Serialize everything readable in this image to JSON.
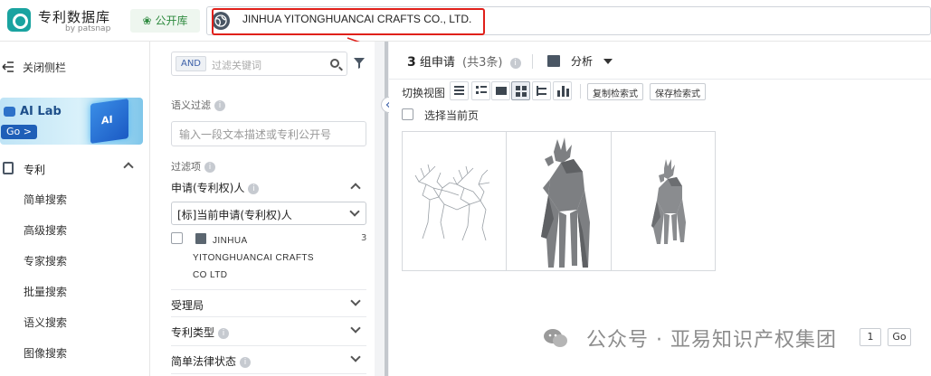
{
  "app": {
    "title": "专利数据库",
    "subtitle": "by patsnap",
    "brand_color": "#1aa3a0",
    "public_db_label": "公开库"
  },
  "search": {
    "query": "JINHUA YITONGHUANCAI CRAFTS CO., LTD.",
    "highlight_color": "#e0201a"
  },
  "sidebar": {
    "collapse_label": "关闭侧栏",
    "ailab": {
      "title": "AI Lab",
      "go": "Go >",
      "cube_text": "AI"
    },
    "patent_label": "专利",
    "items": [
      {
        "label": "简单搜索"
      },
      {
        "label": "高级搜索"
      },
      {
        "label": "专家搜索"
      },
      {
        "label": "批量搜索"
      },
      {
        "label": "语义搜索"
      },
      {
        "label": "图像搜索"
      }
    ]
  },
  "filter": {
    "and_tag": "AND",
    "keyword_placeholder": "过滤关键词",
    "semantic_label": "语义过滤",
    "semantic_placeholder": "输入一段文本描述或专利公开号",
    "filter_items_label": "过滤项",
    "applicant_group": "申请(专利权)人",
    "applicant_select": "[标]当前申请(专利权)人",
    "applicant": {
      "line1": "JINHUA",
      "line2": "YITONGHUANCAI CRAFTS",
      "line3": "CO LTD",
      "count": "3"
    },
    "groups": [
      {
        "label": "受理局"
      },
      {
        "label": "专利类型"
      },
      {
        "label": "简单法律状态"
      }
    ]
  },
  "results": {
    "count": "3",
    "unit": "组申请",
    "total": "(共3条)",
    "analysis_label": "分析",
    "switch_view_label": "切换视图",
    "copy_query": "复制检索式",
    "save_query": "保存检索式",
    "select_page": "选择当前页",
    "images": [
      {
        "alt": "wireframe deer sculptures"
      },
      {
        "alt": "grey low-poly deer"
      },
      {
        "alt": "small grey low-poly deer"
      }
    ]
  },
  "pager": {
    "page": "1",
    "go": "Go"
  },
  "watermark": "公众号 · 亚易知识产权集团"
}
